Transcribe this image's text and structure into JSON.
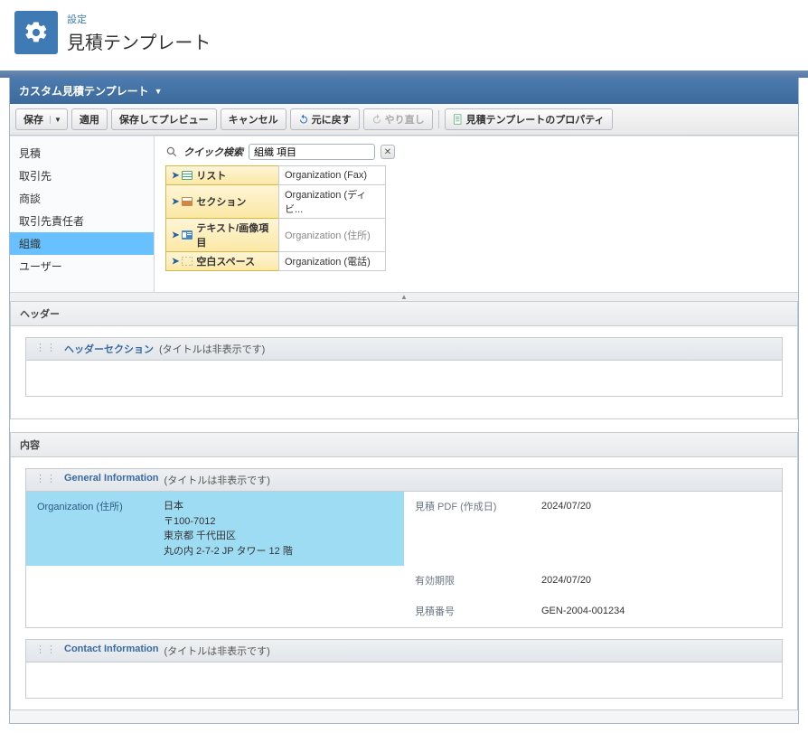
{
  "header": {
    "breadcrumb": "設定",
    "title": "見積テンプレート"
  },
  "panel_title": "カスタム見積テンプレート",
  "toolbar": {
    "save": "保存",
    "apply": "適用",
    "save_preview": "保存してプレビュー",
    "cancel": "キャンセル",
    "undo": "元に戻す",
    "redo": "やり直し",
    "properties": "見積テンプレートのプロパティ"
  },
  "sidebar": {
    "items": [
      {
        "label": "見積"
      },
      {
        "label": "取引先"
      },
      {
        "label": "商談"
      },
      {
        "label": "取引先責任者"
      },
      {
        "label": "組織"
      },
      {
        "label": "ユーザー"
      }
    ],
    "selected_index": 4
  },
  "search": {
    "label": "クイック検索",
    "value": "組織 項目"
  },
  "palette": {
    "element_types": [
      {
        "label": "リスト"
      },
      {
        "label": "セクション"
      },
      {
        "label": "テキスト/画像項目"
      },
      {
        "label": "空白スペース"
      }
    ],
    "results": [
      {
        "label": "Organization (Fax)",
        "disabled": false
      },
      {
        "label": "Organization (ディビ...",
        "disabled": false
      },
      {
        "label": "Organization (住所)",
        "disabled": true
      },
      {
        "label": "Organization (電話)",
        "disabled": false
      }
    ]
  },
  "canvas": {
    "sections": [
      {
        "title": "ヘッダー",
        "subsections": [
          {
            "name": "ヘッダーセクション",
            "hint": "(タイトルは非表示です)",
            "rows": []
          }
        ]
      },
      {
        "title": "内容",
        "subsections": [
          {
            "name": "General Information",
            "hint": "(タイトルは非表示です)",
            "rows": [
              {
                "left": {
                  "label": "Organization (住所)",
                  "value_lines": [
                    "日本",
                    "〒100-7012",
                    "東京都 千代田区",
                    "丸の内 2-7-2 JP タワー 12 階"
                  ],
                  "highlighted": true
                },
                "right": {
                  "label": "見積 PDF (作成日)",
                  "value_lines": [
                    "2024/07/20"
                  ]
                }
              },
              {
                "left": null,
                "right": {
                  "label": "有効期限",
                  "value_lines": [
                    "2024/07/20"
                  ]
                }
              },
              {
                "left": null,
                "right": {
                  "label": "見積番号",
                  "value_lines": [
                    "GEN-2004-001234"
                  ]
                }
              }
            ]
          },
          {
            "name": "Contact Information",
            "hint": "(タイトルは非表示です)",
            "rows": []
          }
        ]
      }
    ]
  }
}
